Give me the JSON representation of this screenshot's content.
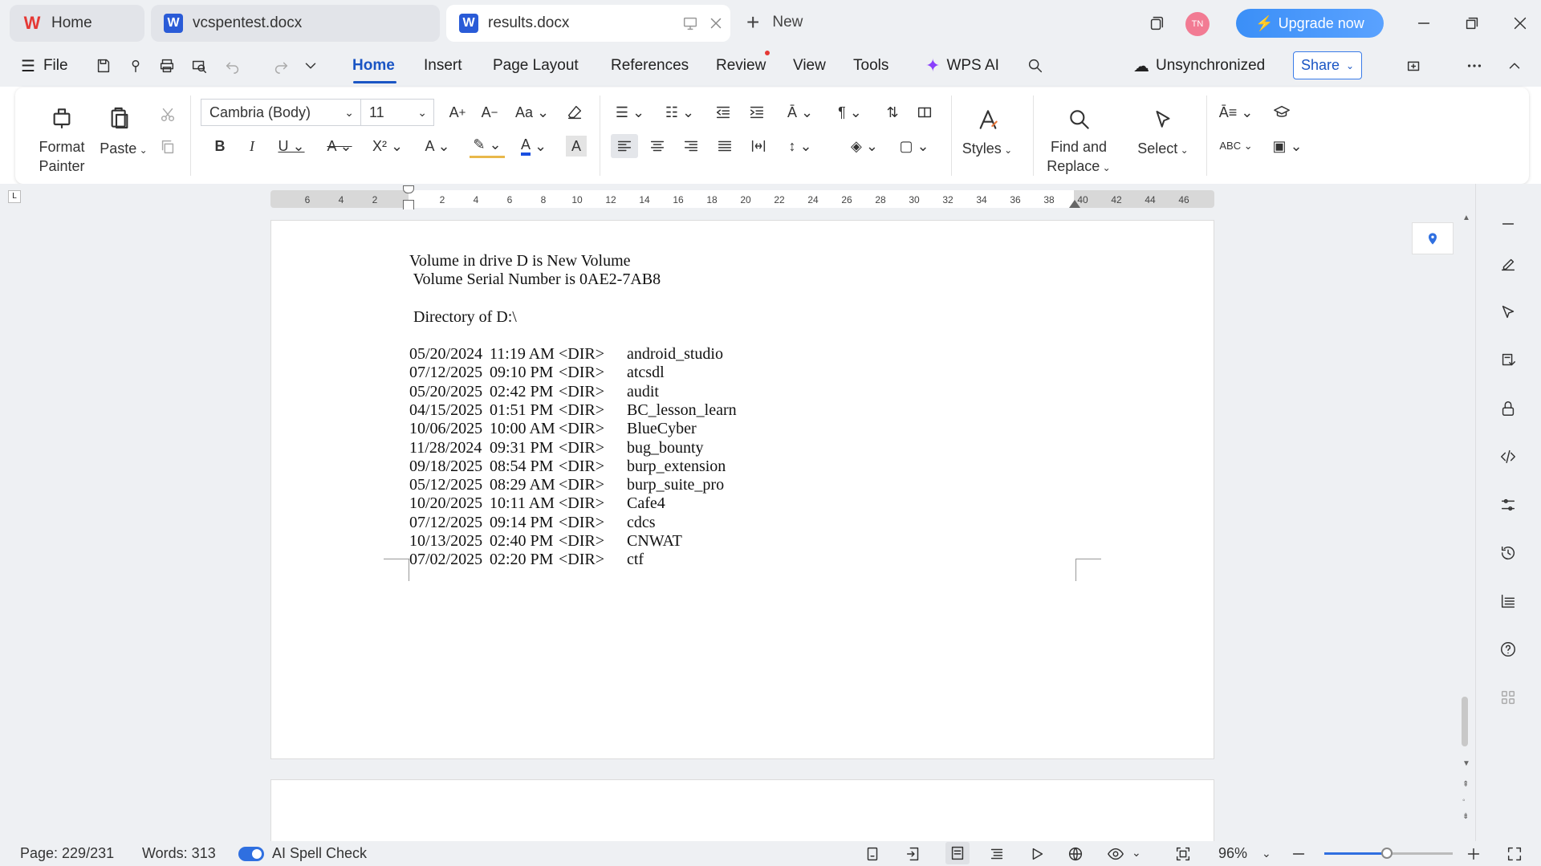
{
  "tabs": {
    "home": "Home",
    "vcs": "vcspentest.docx",
    "results": "results.docx",
    "new": "New"
  },
  "titlebar": {
    "upgrade": "Upgrade now",
    "avatar": "TN"
  },
  "menu": {
    "file": "File",
    "items": [
      "Home",
      "Insert",
      "Page Layout",
      "References",
      "Review",
      "View",
      "Tools",
      "WPS AI"
    ],
    "sync": "Unsynchronized",
    "share": "Share"
  },
  "ribbon": {
    "format_painter": [
      "Format",
      "Painter"
    ],
    "paste": "Paste",
    "font": "Cambria (Body)",
    "size": "11",
    "styles": "Styles",
    "find_replace": [
      "Find and",
      "Replace"
    ],
    "select": "Select"
  },
  "ruler": {
    "left_ticks": [
      "6",
      "4",
      "2"
    ],
    "right_ticks": [
      "2",
      "4",
      "6",
      "8",
      "10",
      "12",
      "14",
      "16",
      "18",
      "20",
      "22",
      "24",
      "26",
      "28",
      "30",
      "32",
      "34",
      "36",
      "38",
      "40",
      "42",
      "44",
      "46"
    ]
  },
  "document": {
    "line1": "Volume in drive D is New Volume",
    "line2": " Volume Serial Number is 0AE2-7AB8",
    "line3": " Directory of D:\\",
    "rows": [
      {
        "date": "05/20/2024",
        "time": "11:19 AM",
        "type": "<DIR>",
        "name": "android_studio"
      },
      {
        "date": "07/12/2025",
        "time": "09:10 PM",
        "type": "<DIR>",
        "name": "atcsdl"
      },
      {
        "date": "05/20/2025",
        "time": "02:42 PM",
        "type": "<DIR>",
        "name": "audit"
      },
      {
        "date": "04/15/2025",
        "time": "01:51 PM",
        "type": "<DIR>",
        "name": "BC_lesson_learn"
      },
      {
        "date": "10/06/2025",
        "time": "10:00 AM",
        "type": "<DIR>",
        "name": "BlueCyber"
      },
      {
        "date": "11/28/2024",
        "time": "09:31 PM",
        "type": "<DIR>",
        "name": "bug_bounty"
      },
      {
        "date": "09/18/2025",
        "time": "08:54 PM",
        "type": "<DIR>",
        "name": "burp_extension"
      },
      {
        "date": "05/12/2025",
        "time": "08:29 AM",
        "type": "<DIR>",
        "name": "burp_suite_pro"
      },
      {
        "date": "10/20/2025",
        "time": "10:11 AM",
        "type": "<DIR>",
        "name": "Cafe4"
      },
      {
        "date": "07/12/2025",
        "time": "09:14 PM",
        "type": "<DIR>",
        "name": "cdcs"
      },
      {
        "date": "10/13/2025",
        "time": "02:40 PM",
        "type": "<DIR>",
        "name": "CNWAT"
      },
      {
        "date": "07/02/2025",
        "time": "02:20 PM",
        "type": "<DIR>",
        "name": "ctf"
      }
    ]
  },
  "status": {
    "page": "Page: 229/231",
    "words": "Words: 313",
    "spell": "AI Spell Check",
    "zoom": "96%",
    "zoom_fraction": 0.48
  },
  "colors": {
    "accent": "#1a55c4",
    "upgrade": "#3b8ff7",
    "avatar": "#f27b93",
    "chrome": "#eef0f3"
  }
}
